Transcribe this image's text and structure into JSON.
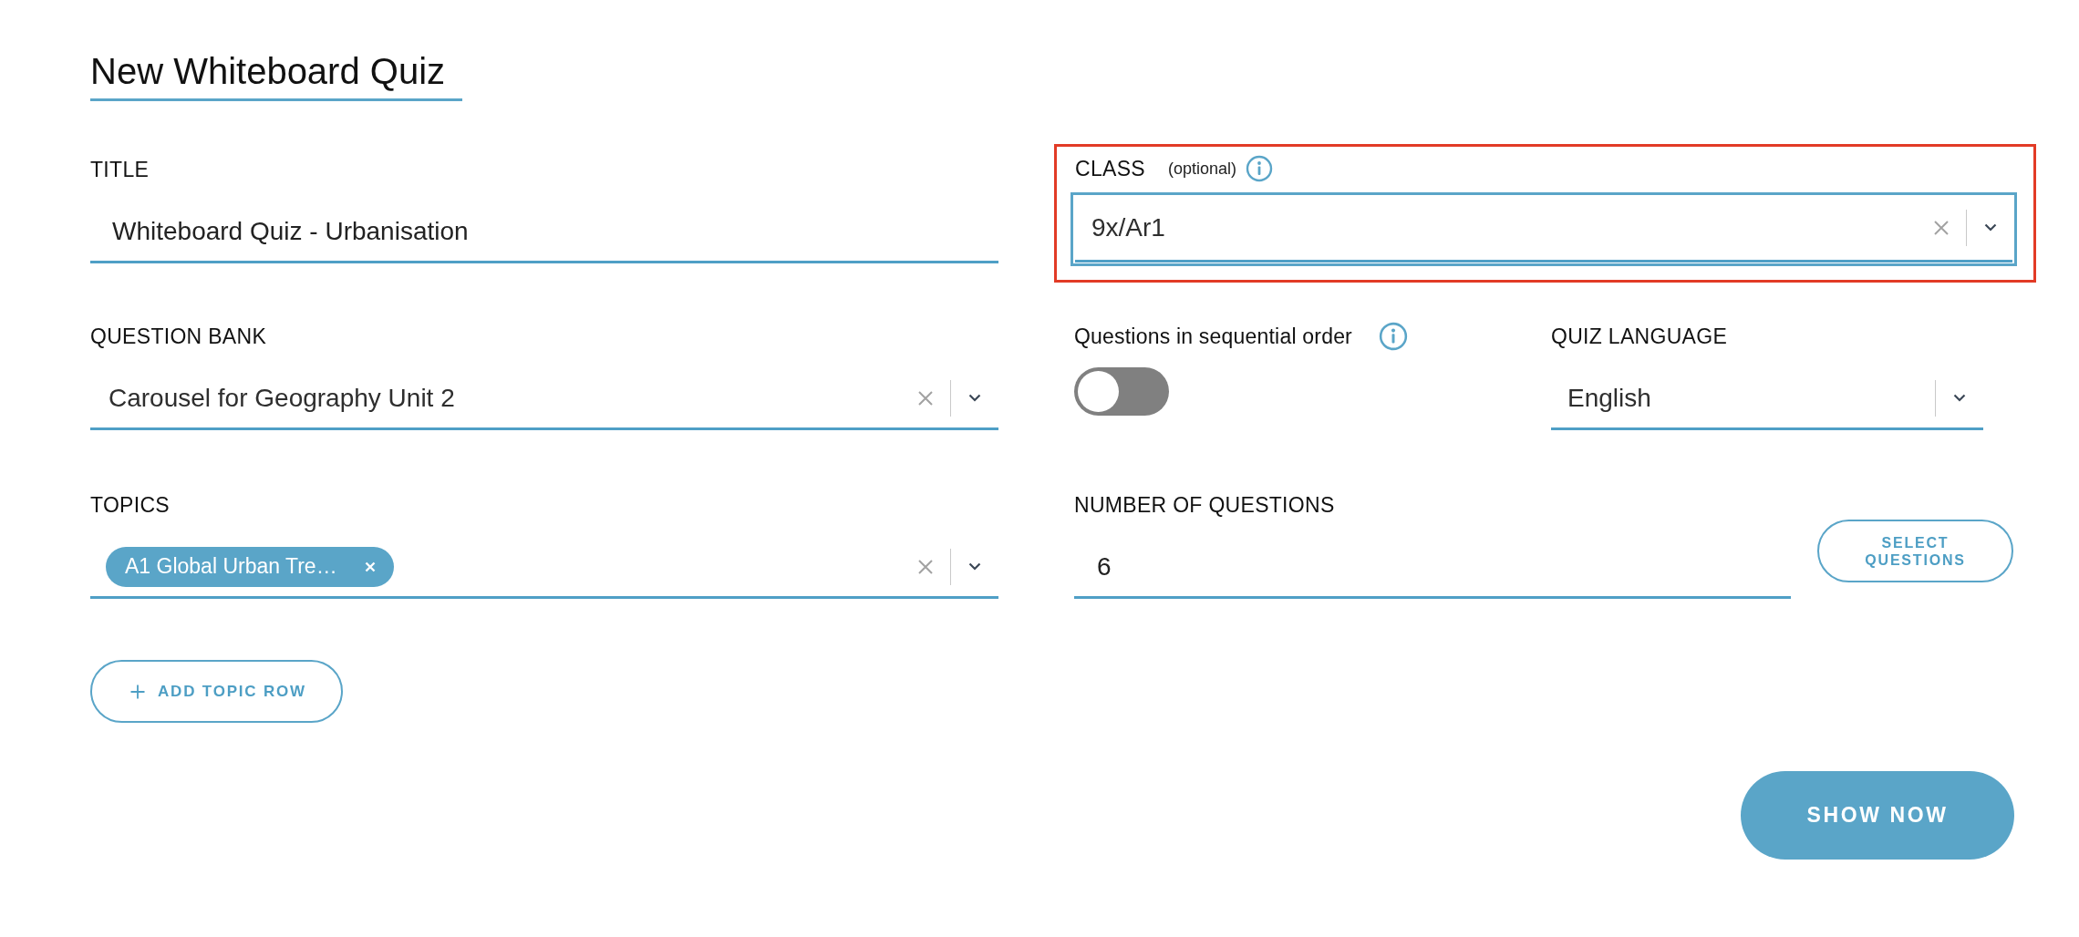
{
  "page": {
    "title": "New Whiteboard Quiz"
  },
  "title_field": {
    "label": "TITLE",
    "value": "Whiteboard Quiz - Urbanisation"
  },
  "class": {
    "label": "CLASS",
    "note": "(optional)",
    "value": "9x/Ar1",
    "clearable": true,
    "focused": true,
    "highlighted": true
  },
  "question_bank": {
    "label": "QUESTION BANK",
    "value": "Carousel for Geography Unit 2",
    "clearable": true
  },
  "sequential": {
    "label": "Questions in sequential order",
    "on": false
  },
  "quiz_language": {
    "label": "QUIZ LANGUAGE",
    "value": "English",
    "clearable": false
  },
  "topics": {
    "label": "TOPICS",
    "tags": [
      {
        "label": "A1 Global Urban Tre…"
      }
    ],
    "clearable": true
  },
  "number_of_questions": {
    "label": "NUMBER OF QUESTIONS",
    "value": "6"
  },
  "buttons": {
    "select_questions": "SELECT QUESTIONS",
    "add_topic_row": "ADD TOPIC ROW",
    "show_now": "SHOW NOW"
  }
}
